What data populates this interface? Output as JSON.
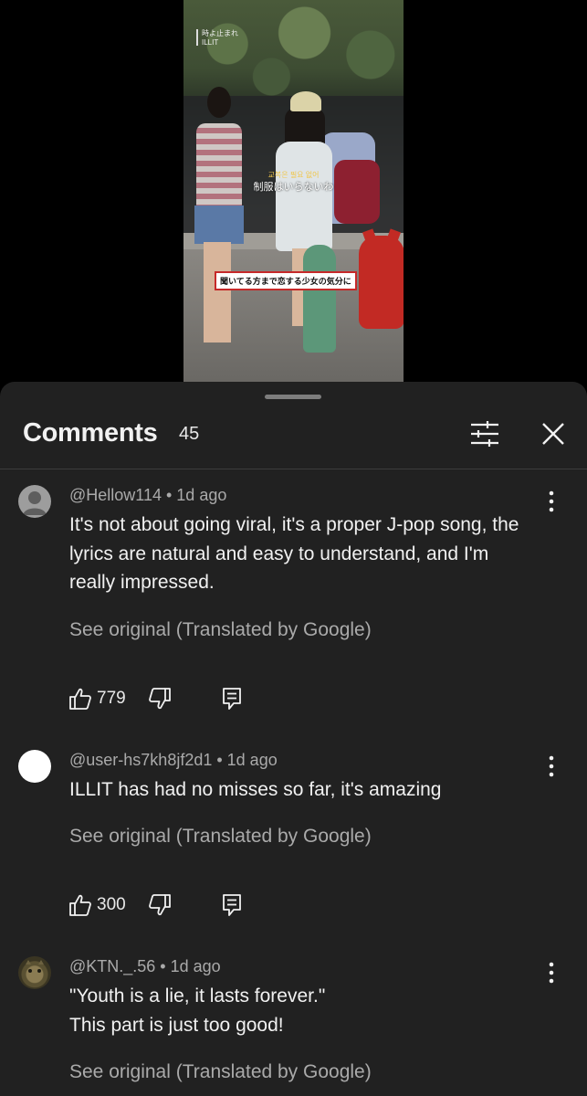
{
  "video": {
    "header_line1": "時よ止まれ",
    "header_line2": "ILLIT",
    "subtitle_korean": "교복은 필요 없어",
    "subtitle_japanese": "制服はいらないわ",
    "subtitle_boxed": "聞いてる方まで恋する少女の気分に"
  },
  "comments_panel": {
    "title": "Comments",
    "count": "45",
    "filter_icon": "sliders-icon",
    "close_icon": "close-icon"
  },
  "comments": [
    {
      "handle": "@Hellow114",
      "time": "1d ago",
      "meta": "@Hellow114 • 1d ago",
      "text_lines": [
        "It's not about going viral, it's a proper J-pop song, the",
        "lyrics are natural and easy to understand, and I'm",
        "really impressed."
      ],
      "translation_note": "See original (Translated by Google)",
      "likes": "779",
      "avatar": "default-gray"
    },
    {
      "handle": "@user-hs7kh8jf2d1",
      "time": "1d ago",
      "meta": "@user-hs7kh8jf2d1 • 1d ago",
      "text_lines": [
        "ILLIT has had no misses so far, it's amazing"
      ],
      "translation_note": "See original (Translated by Google)",
      "likes": "300",
      "avatar": "white"
    },
    {
      "handle": "@KTN._.56",
      "time": "1d ago",
      "meta": "@KTN._.56 • 1d ago",
      "text_lines": [
        "\"Youth is a lie, it lasts forever.\"",
        "This part is just too good!"
      ],
      "translation_note": "See original (Translated by Google)",
      "avatar": "photo"
    }
  ],
  "colors": {
    "sheet_bg": "#212121",
    "page_bg": "#000000",
    "primary_text": "#f1f1f1",
    "secondary_text": "#aaaaaa"
  }
}
